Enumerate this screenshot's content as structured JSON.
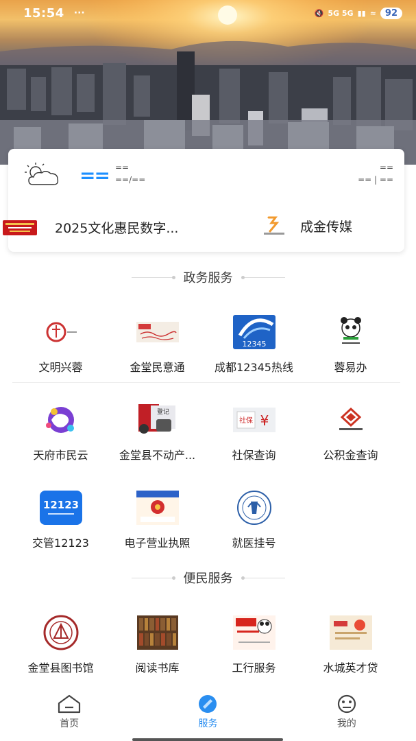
{
  "status_bar": {
    "time": "15:54",
    "dots": "···",
    "network": "5G 5G",
    "battery": "92"
  },
  "weather": {
    "icon": "partly-cloudy-icon",
    "temp": "==",
    "line1": "==",
    "line2": "==/==",
    "right1": "==",
    "right2": "== | =="
  },
  "news": [
    {
      "thumb": "red-banner-thumb",
      "text": "2025文化惠民数字..."
    },
    {
      "thumb": "chengjin-logo",
      "text": "成金传媒"
    }
  ],
  "sections": [
    {
      "title": "政务服务",
      "rows": [
        [
          {
            "label": "文明兴蓉",
            "icon": "wenming-icon"
          },
          {
            "label": "金堂民意通",
            "icon": "minyitong-icon"
          },
          {
            "label": "成都12345热线",
            "icon": "hotline-12345-icon"
          },
          {
            "label": "蓉易办",
            "icon": "panda-icon"
          }
        ],
        [
          {
            "label": "天府市民云",
            "icon": "tianfu-cloud-icon"
          },
          {
            "label": "金堂县不动产...",
            "icon": "property-register-icon"
          },
          {
            "label": "社保查询",
            "icon": "social-security-icon"
          },
          {
            "label": "公积金查询",
            "icon": "housing-fund-icon"
          }
        ],
        [
          {
            "label": "交管12123",
            "icon": "traffic-12123-icon"
          },
          {
            "label": "电子营业执照",
            "icon": "business-license-icon"
          },
          {
            "label": "就医挂号",
            "icon": "hospital-register-icon"
          }
        ]
      ]
    },
    {
      "title": "便民服务",
      "rows": [
        [
          {
            "label": "金堂县图书馆",
            "icon": "library-icon"
          },
          {
            "label": "阅读书库",
            "icon": "bookshelf-icon"
          },
          {
            "label": "工行服务",
            "icon": "icbc-icon"
          },
          {
            "label": "水城英才贷",
            "icon": "talent-loan-icon"
          }
        ]
      ]
    }
  ],
  "tabs": [
    {
      "label": "首页",
      "icon": "home-icon",
      "active": false
    },
    {
      "label": "服务",
      "icon": "service-icon",
      "active": true
    },
    {
      "label": "我的",
      "icon": "profile-icon",
      "active": false
    }
  ],
  "colors": {
    "accent": "#2a8ef0",
    "weather_temp": "#1e90ff"
  }
}
